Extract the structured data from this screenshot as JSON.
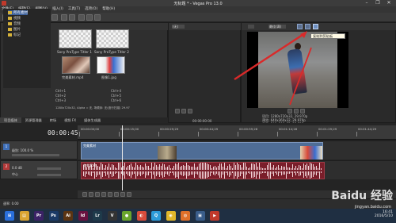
{
  "window": {
    "title": "无标题 * - Vegas Pro 13.0",
    "controls": [
      "–",
      "❐",
      "✕"
    ]
  },
  "menu": [
    "文件(F)",
    "编辑(E)",
    "视图(V)",
    "插入(I)",
    "工具(T)",
    "选项(O)",
    "帮助(H)"
  ],
  "explorer": {
    "tree": [
      "所有素材",
      "视频",
      "音频",
      "图片",
      "标记"
    ],
    "media": [
      {
        "label": "Sony ProType Titler 1"
      },
      {
        "label": "Sony ProType Titler 2"
      },
      {
        "label": "完美素材.mp4"
      },
      {
        "label": "图像1.jpg"
      }
    ],
    "props": [
      "Ctrl+1",
      "Ctrl+2",
      "Ctrl+3",
      "Ctrl+4",
      "Ctrl+5",
      "Ctrl+6",
      "1280x720x32, Alpha = 无, 场顺序: 无(逐行扫描) 29.97"
    ],
    "tabs": [
      "项目媒体",
      "资源管理器",
      "转场",
      "视频 FX",
      "媒体生成器"
    ]
  },
  "trimmer": {
    "dropdown": "(无)",
    "time": "00:00:00:00"
  },
  "preview": {
    "preset": "最佳(满)",
    "tooltip": "复制到剪贴板",
    "info": [
      "项目: 1280x720x32, 29.970p",
      "预览: 640x360x32, 29.970p",
      "显示: 349x196x32, 15.323p"
    ],
    "timecode": "00:00:45;08"
  },
  "timeline": {
    "timecode": "00:00:45;08",
    "ruler": [
      "00:00:00;00",
      "00:00:15;00",
      "00:00:29;29",
      "00:00:44;29",
      "00:00:59;28",
      "00:01:14;28",
      "00:01:29;29",
      "00:01:44;29"
    ],
    "video_track": {
      "num": "1",
      "label": "级别: 100.0 %",
      "clip": "完美素材"
    },
    "audio_track": {
      "num": "2",
      "vol": "0.0 dB",
      "pan": "中心",
      "clip": "完美素材"
    },
    "rate": "速率: 0.00"
  },
  "taskbar": {
    "icons": [
      {
        "name": "windows",
        "color": "#2a6fdb",
        "glyph": "⊞"
      },
      {
        "name": "explorer",
        "color": "#d8a331",
        "glyph": "▤"
      },
      {
        "name": "premiere",
        "color": "#3b2266",
        "glyph": "Pr"
      },
      {
        "name": "photoshop",
        "color": "#1b3a66",
        "glyph": "Ps"
      },
      {
        "name": "illustrator",
        "color": "#5b3412",
        "glyph": "Ai"
      },
      {
        "name": "indesign",
        "color": "#6a1240",
        "glyph": "Id"
      },
      {
        "name": "lightroom",
        "color": "#1e3a4a",
        "glyph": "Lr"
      },
      {
        "name": "vegas",
        "color": "#333",
        "glyph": "V"
      },
      {
        "name": "app",
        "color": "#6aa52c",
        "glyph": "●"
      },
      {
        "name": "color",
        "color": "#d84c3c",
        "glyph": "◐"
      },
      {
        "name": "qq",
        "color": "#2c9bd8",
        "glyph": "Q"
      },
      {
        "name": "chrome",
        "color": "#e0b62a",
        "glyph": "◉"
      },
      {
        "name": "firefox",
        "color": "#e0702a",
        "glyph": "◍"
      },
      {
        "name": "app2",
        "color": "#3a5d8a",
        "glyph": "▣"
      },
      {
        "name": "app3",
        "color": "#c0392b",
        "glyph": "▶"
      }
    ],
    "time": "16:41",
    "date": "2016/5/10"
  },
  "watermark": {
    "brand": "Baidu 经验",
    "url": "jingyan.baidu.com"
  }
}
